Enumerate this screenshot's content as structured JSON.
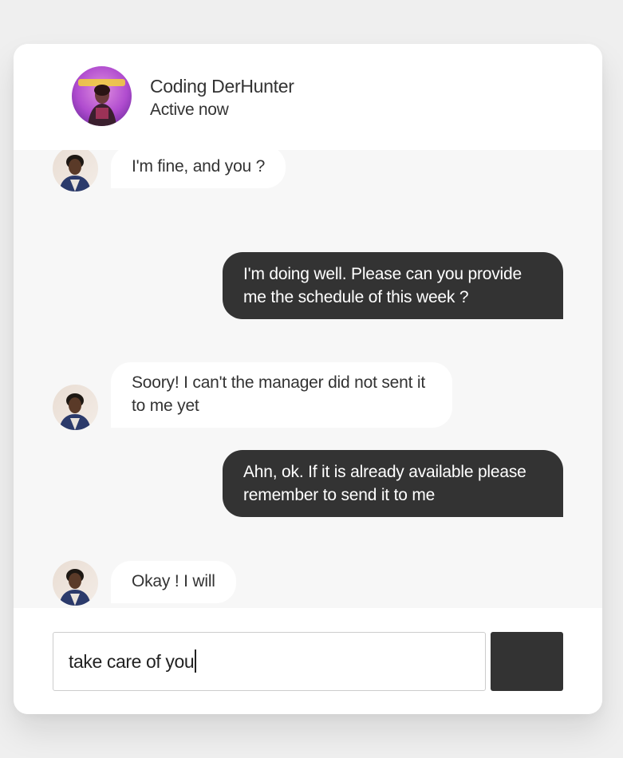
{
  "contact": {
    "name": "Coding DerHunter",
    "status": "Active now"
  },
  "messages": [
    {
      "sender": "contact",
      "text": "I'm fine, and you ?"
    },
    {
      "sender": "me",
      "text": "I'm doing well. Please can you provide me the schedule of this week ?"
    },
    {
      "sender": "contact",
      "text": "Soory! I can't the manager did not sent it to me yet"
    },
    {
      "sender": "me",
      "text": "Ahn, ok. If it is already available please remember to send it to me"
    },
    {
      "sender": "contact",
      "text": "Okay ! I will"
    }
  ],
  "composer": {
    "input_value": "take care of you"
  },
  "colors": {
    "page_background": "#efefef",
    "card_background": "#ffffff",
    "messages_background": "#f7f7f7",
    "outgoing_bubble": "#333333",
    "incoming_bubble": "#ffffff",
    "send_button": "#333333",
    "text_dark": "#333333"
  },
  "icons": {
    "header_avatar": "contact-profile-photo",
    "message_avatar": "contact-avatar-photo"
  }
}
